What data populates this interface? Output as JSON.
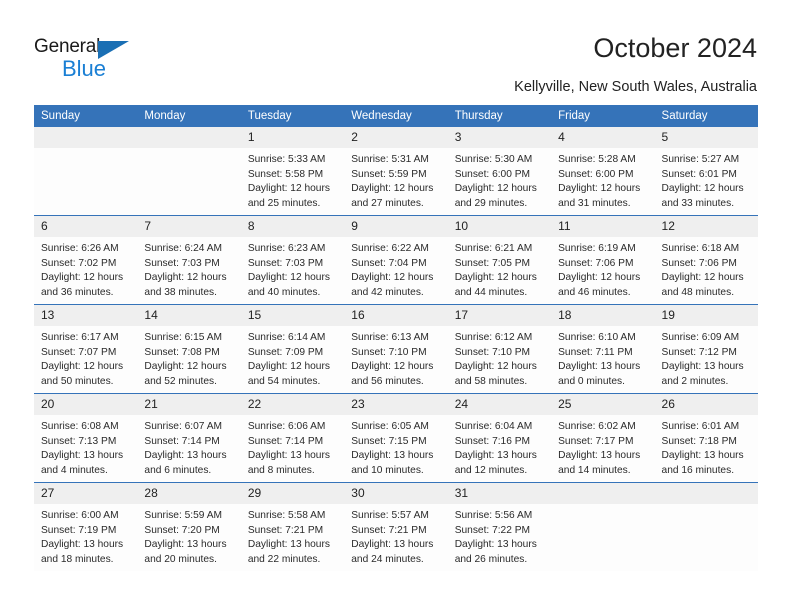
{
  "brand": {
    "name_part1": "General",
    "name_part2": "Blue",
    "triangle_color": "#1a6fb4",
    "blue_color": "#1a7fd4"
  },
  "header": {
    "title": "October 2024",
    "location": "Kellyville, New South Wales, Australia"
  },
  "theme": {
    "header_blue": "#3573b9",
    "daynum_gray": "#efefef",
    "cell_bg": "#fdfdfd",
    "text": "#222222"
  },
  "weekday_headers": [
    "Sunday",
    "Monday",
    "Tuesday",
    "Wednesday",
    "Thursday",
    "Friday",
    "Saturday"
  ],
  "weeks": [
    [
      {
        "day": "",
        "sunrise": "",
        "sunset": "",
        "daylight1": "",
        "daylight2": "",
        "empty": true
      },
      {
        "day": "",
        "sunrise": "",
        "sunset": "",
        "daylight1": "",
        "daylight2": "",
        "empty": true
      },
      {
        "day": "1",
        "sunrise": "Sunrise: 5:33 AM",
        "sunset": "Sunset: 5:58 PM",
        "daylight1": "Daylight: 12 hours",
        "daylight2": "and 25 minutes."
      },
      {
        "day": "2",
        "sunrise": "Sunrise: 5:31 AM",
        "sunset": "Sunset: 5:59 PM",
        "daylight1": "Daylight: 12 hours",
        "daylight2": "and 27 minutes."
      },
      {
        "day": "3",
        "sunrise": "Sunrise: 5:30 AM",
        "sunset": "Sunset: 6:00 PM",
        "daylight1": "Daylight: 12 hours",
        "daylight2": "and 29 minutes."
      },
      {
        "day": "4",
        "sunrise": "Sunrise: 5:28 AM",
        "sunset": "Sunset: 6:00 PM",
        "daylight1": "Daylight: 12 hours",
        "daylight2": "and 31 minutes."
      },
      {
        "day": "5",
        "sunrise": "Sunrise: 5:27 AM",
        "sunset": "Sunset: 6:01 PM",
        "daylight1": "Daylight: 12 hours",
        "daylight2": "and 33 minutes."
      }
    ],
    [
      {
        "day": "6",
        "sunrise": "Sunrise: 6:26 AM",
        "sunset": "Sunset: 7:02 PM",
        "daylight1": "Daylight: 12 hours",
        "daylight2": "and 36 minutes."
      },
      {
        "day": "7",
        "sunrise": "Sunrise: 6:24 AM",
        "sunset": "Sunset: 7:03 PM",
        "daylight1": "Daylight: 12 hours",
        "daylight2": "and 38 minutes."
      },
      {
        "day": "8",
        "sunrise": "Sunrise: 6:23 AM",
        "sunset": "Sunset: 7:03 PM",
        "daylight1": "Daylight: 12 hours",
        "daylight2": "and 40 minutes."
      },
      {
        "day": "9",
        "sunrise": "Sunrise: 6:22 AM",
        "sunset": "Sunset: 7:04 PM",
        "daylight1": "Daylight: 12 hours",
        "daylight2": "and 42 minutes."
      },
      {
        "day": "10",
        "sunrise": "Sunrise: 6:21 AM",
        "sunset": "Sunset: 7:05 PM",
        "daylight1": "Daylight: 12 hours",
        "daylight2": "and 44 minutes."
      },
      {
        "day": "11",
        "sunrise": "Sunrise: 6:19 AM",
        "sunset": "Sunset: 7:06 PM",
        "daylight1": "Daylight: 12 hours",
        "daylight2": "and 46 minutes."
      },
      {
        "day": "12",
        "sunrise": "Sunrise: 6:18 AM",
        "sunset": "Sunset: 7:06 PM",
        "daylight1": "Daylight: 12 hours",
        "daylight2": "and 48 minutes."
      }
    ],
    [
      {
        "day": "13",
        "sunrise": "Sunrise: 6:17 AM",
        "sunset": "Sunset: 7:07 PM",
        "daylight1": "Daylight: 12 hours",
        "daylight2": "and 50 minutes."
      },
      {
        "day": "14",
        "sunrise": "Sunrise: 6:15 AM",
        "sunset": "Sunset: 7:08 PM",
        "daylight1": "Daylight: 12 hours",
        "daylight2": "and 52 minutes."
      },
      {
        "day": "15",
        "sunrise": "Sunrise: 6:14 AM",
        "sunset": "Sunset: 7:09 PM",
        "daylight1": "Daylight: 12 hours",
        "daylight2": "and 54 minutes."
      },
      {
        "day": "16",
        "sunrise": "Sunrise: 6:13 AM",
        "sunset": "Sunset: 7:10 PM",
        "daylight1": "Daylight: 12 hours",
        "daylight2": "and 56 minutes."
      },
      {
        "day": "17",
        "sunrise": "Sunrise: 6:12 AM",
        "sunset": "Sunset: 7:10 PM",
        "daylight1": "Daylight: 12 hours",
        "daylight2": "and 58 minutes."
      },
      {
        "day": "18",
        "sunrise": "Sunrise: 6:10 AM",
        "sunset": "Sunset: 7:11 PM",
        "daylight1": "Daylight: 13 hours",
        "daylight2": "and 0 minutes."
      },
      {
        "day": "19",
        "sunrise": "Sunrise: 6:09 AM",
        "sunset": "Sunset: 7:12 PM",
        "daylight1": "Daylight: 13 hours",
        "daylight2": "and 2 minutes."
      }
    ],
    [
      {
        "day": "20",
        "sunrise": "Sunrise: 6:08 AM",
        "sunset": "Sunset: 7:13 PM",
        "daylight1": "Daylight: 13 hours",
        "daylight2": "and 4 minutes."
      },
      {
        "day": "21",
        "sunrise": "Sunrise: 6:07 AM",
        "sunset": "Sunset: 7:14 PM",
        "daylight1": "Daylight: 13 hours",
        "daylight2": "and 6 minutes."
      },
      {
        "day": "22",
        "sunrise": "Sunrise: 6:06 AM",
        "sunset": "Sunset: 7:14 PM",
        "daylight1": "Daylight: 13 hours",
        "daylight2": "and 8 minutes."
      },
      {
        "day": "23",
        "sunrise": "Sunrise: 6:05 AM",
        "sunset": "Sunset: 7:15 PM",
        "daylight1": "Daylight: 13 hours",
        "daylight2": "and 10 minutes."
      },
      {
        "day": "24",
        "sunrise": "Sunrise: 6:04 AM",
        "sunset": "Sunset: 7:16 PM",
        "daylight1": "Daylight: 13 hours",
        "daylight2": "and 12 minutes."
      },
      {
        "day": "25",
        "sunrise": "Sunrise: 6:02 AM",
        "sunset": "Sunset: 7:17 PM",
        "daylight1": "Daylight: 13 hours",
        "daylight2": "and 14 minutes."
      },
      {
        "day": "26",
        "sunrise": "Sunrise: 6:01 AM",
        "sunset": "Sunset: 7:18 PM",
        "daylight1": "Daylight: 13 hours",
        "daylight2": "and 16 minutes."
      }
    ],
    [
      {
        "day": "27",
        "sunrise": "Sunrise: 6:00 AM",
        "sunset": "Sunset: 7:19 PM",
        "daylight1": "Daylight: 13 hours",
        "daylight2": "and 18 minutes."
      },
      {
        "day": "28",
        "sunrise": "Sunrise: 5:59 AM",
        "sunset": "Sunset: 7:20 PM",
        "daylight1": "Daylight: 13 hours",
        "daylight2": "and 20 minutes."
      },
      {
        "day": "29",
        "sunrise": "Sunrise: 5:58 AM",
        "sunset": "Sunset: 7:21 PM",
        "daylight1": "Daylight: 13 hours",
        "daylight2": "and 22 minutes."
      },
      {
        "day": "30",
        "sunrise": "Sunrise: 5:57 AM",
        "sunset": "Sunset: 7:21 PM",
        "daylight1": "Daylight: 13 hours",
        "daylight2": "and 24 minutes."
      },
      {
        "day": "31",
        "sunrise": "Sunrise: 5:56 AM",
        "sunset": "Sunset: 7:22 PM",
        "daylight1": "Daylight: 13 hours",
        "daylight2": "and 26 minutes."
      },
      {
        "day": "",
        "sunrise": "",
        "sunset": "",
        "daylight1": "",
        "daylight2": "",
        "empty": true
      },
      {
        "day": "",
        "sunrise": "",
        "sunset": "",
        "daylight1": "",
        "daylight2": "",
        "empty": true
      }
    ]
  ]
}
